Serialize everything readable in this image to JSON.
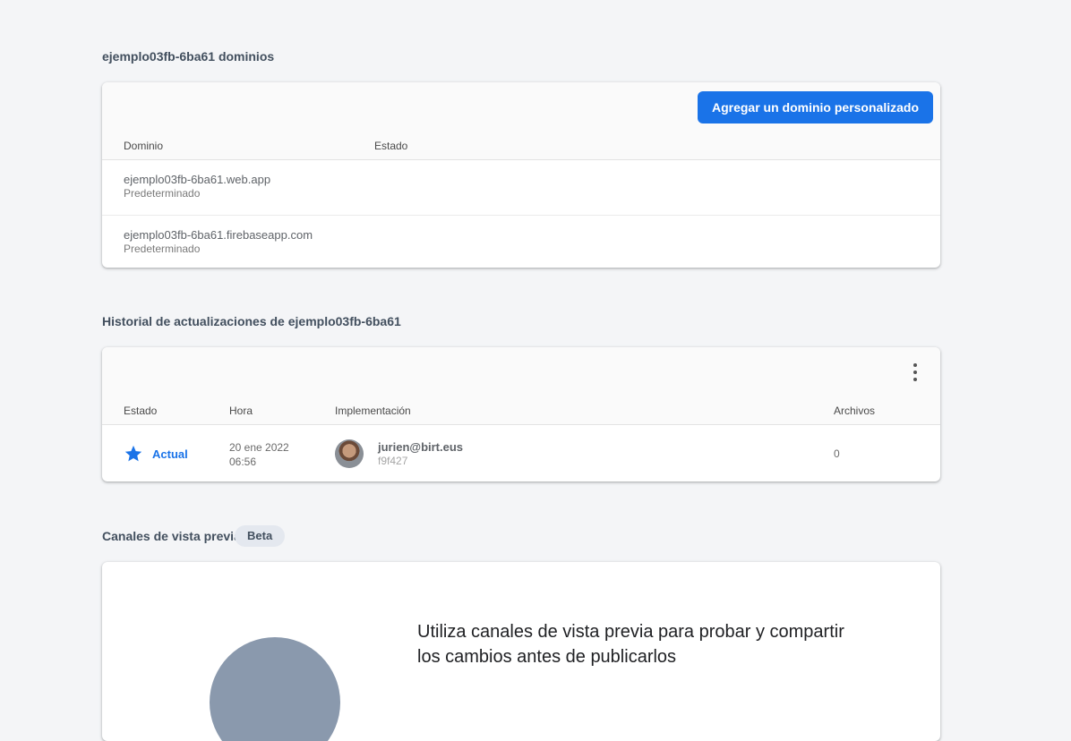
{
  "domains_section": {
    "title": "ejemplo03fb-6ba61 dominios",
    "add_domain_button": "Agregar un dominio personalizado",
    "columns": {
      "domain": "Dominio",
      "status": "Estado"
    },
    "rows": [
      {
        "domain": "ejemplo03fb-6ba61.web.app",
        "sub": "Predeterminado"
      },
      {
        "domain": "ejemplo03fb-6ba61.firebaseapp.com",
        "sub": "Predeterminado"
      }
    ]
  },
  "history_section": {
    "title": "Historial de actualizaciones de ejemplo03fb-6ba61",
    "menu_icon": "more-vert-icon",
    "columns": {
      "status": "Estado",
      "time": "Hora",
      "deployment": "Implementación",
      "files": "Archivos"
    },
    "rows": [
      {
        "status_icon": "star-icon",
        "status": "Actual",
        "date": "20 ene 2022",
        "time": "06:56",
        "user": "jurien@birt.eus",
        "hash": "f9f427",
        "files": "0"
      }
    ]
  },
  "preview_section": {
    "title": "Canales de vista previa",
    "badge": "Beta",
    "headline": "Utiliza canales de vista previa para probar y compartir los cambios antes de publicarlos"
  },
  "colors": {
    "accent": "#1a73e8",
    "background": "#f4f5f7",
    "title": "#424f5e"
  }
}
